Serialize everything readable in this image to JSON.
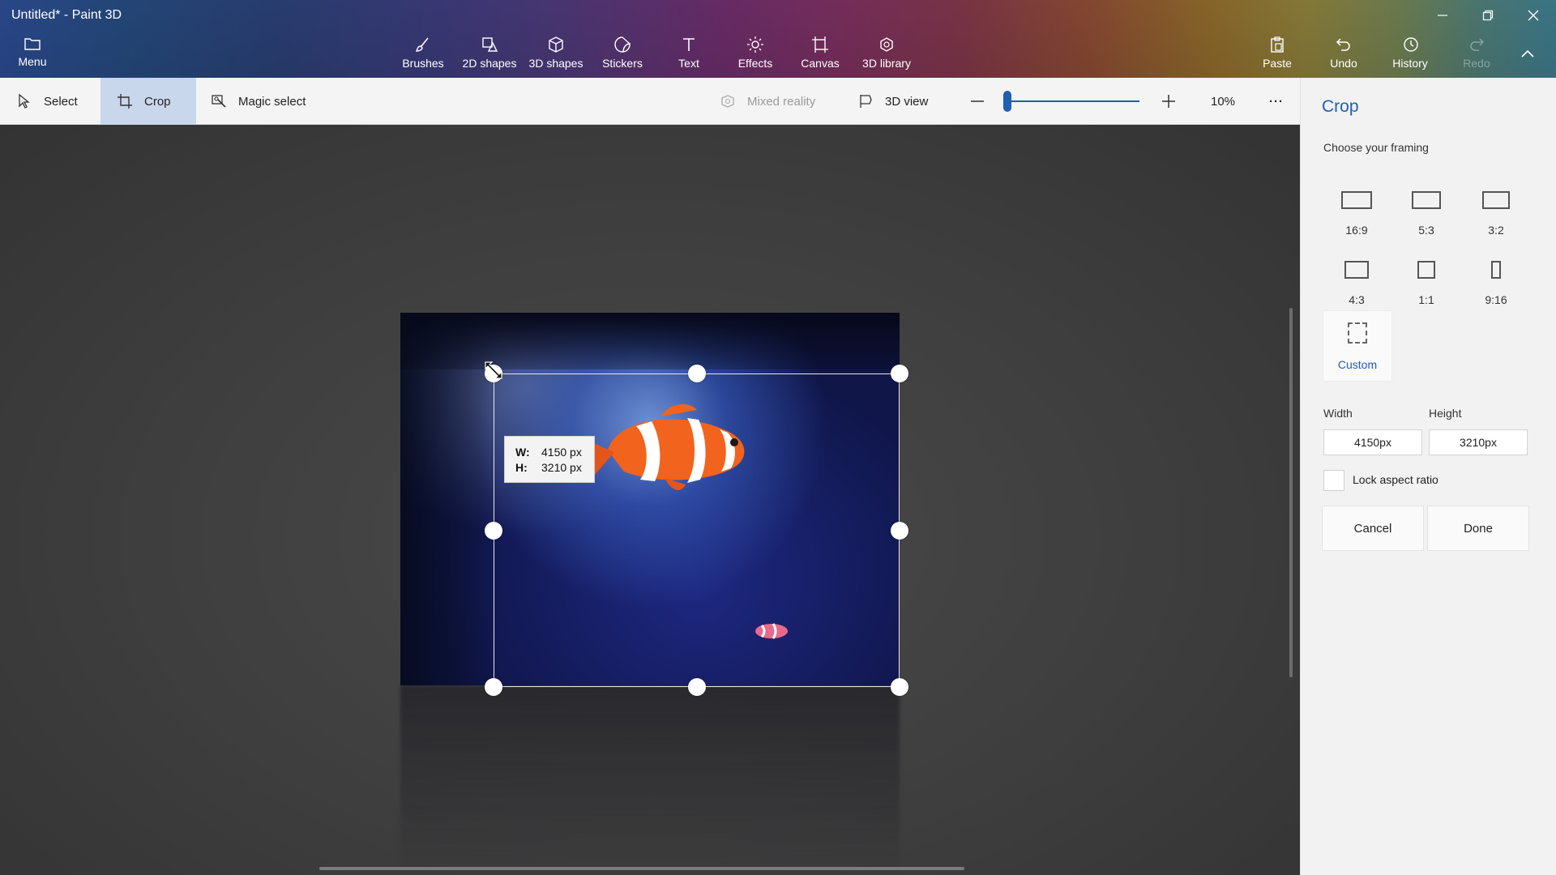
{
  "window": {
    "title": "Untitled* - Paint 3D"
  },
  "ribbon": {
    "menu_label": "Menu",
    "tools": [
      {
        "id": "brushes",
        "label": "Brushes",
        "icon": "brush-icon"
      },
      {
        "id": "2d-shapes",
        "label": "2D shapes",
        "icon": "2d-shapes-icon"
      },
      {
        "id": "3d-shapes",
        "label": "3D shapes",
        "icon": "3d-cube-icon"
      },
      {
        "id": "stickers",
        "label": "Stickers",
        "icon": "sticker-icon"
      },
      {
        "id": "text",
        "label": "Text",
        "icon": "text-icon"
      },
      {
        "id": "effects",
        "label": "Effects",
        "icon": "sun-icon"
      },
      {
        "id": "canvas",
        "label": "Canvas",
        "icon": "canvas-icon"
      },
      {
        "id": "3d-library",
        "label": "3D library",
        "icon": "3d-library-icon"
      }
    ],
    "right_tools": [
      {
        "id": "paste",
        "label": "Paste",
        "icon": "paste-icon",
        "enabled": true
      },
      {
        "id": "undo",
        "label": "Undo",
        "icon": "undo-icon",
        "enabled": true
      },
      {
        "id": "history",
        "label": "History",
        "icon": "history-icon",
        "enabled": true
      },
      {
        "id": "redo",
        "label": "Redo",
        "icon": "redo-icon",
        "enabled": false
      }
    ]
  },
  "toolbar": {
    "select_label": "Select",
    "crop_label": "Crop",
    "magic_select_label": "Magic select",
    "mixed_reality_label": "Mixed reality",
    "view_3d_label": "3D view",
    "zoom_value": "10%",
    "zoom_slider_fraction": 0.02,
    "more_label": "···"
  },
  "canvas": {
    "tooltip_w_key": "W:",
    "tooltip_w_value": "4150 px",
    "tooltip_h_key": "H:",
    "tooltip_h_value": "3210 px"
  },
  "panel": {
    "title": "Crop",
    "subtitle": "Choose your framing",
    "ratios": [
      "16:9",
      "5:3",
      "3:2",
      "4:3",
      "1:1",
      "9:16"
    ],
    "custom_label": "Custom",
    "width_label": "Width",
    "height_label": "Height",
    "width_value": "4150px",
    "height_value": "3210px",
    "lock_label": "Lock aspect ratio",
    "lock_checked": false,
    "cancel_label": "Cancel",
    "done_label": "Done"
  },
  "colors": {
    "accent": "#1f5fb4",
    "active_tool_bg": "#c9d7ec"
  }
}
